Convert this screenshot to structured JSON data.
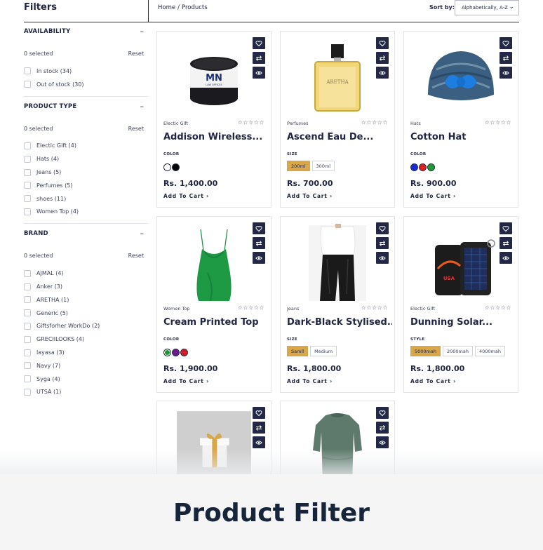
{
  "header": {
    "filters_title": "Filters",
    "breadcrumb": {
      "home": "Home",
      "separator": "/",
      "current": "Products"
    },
    "sort_label": "Sort by:",
    "sort_value": "Alphabetically, A-Z"
  },
  "sidebar": {
    "availability": {
      "title": "AVAILABILITY",
      "selected": "0 selected",
      "reset": "Reset",
      "options": [
        "In stock (34)",
        "Out of stock (30)"
      ]
    },
    "product_type": {
      "title": "PRODUCT TYPE",
      "selected": "0 selected",
      "reset": "Reset",
      "options": [
        "Electic Gift (4)",
        "Hats (4)",
        "Jeans (5)",
        "Perfumes (5)",
        "shoes (11)",
        "Women Top (4)"
      ]
    },
    "brand": {
      "title": "BRAND",
      "selected": "0 selected",
      "reset": "Reset",
      "options": [
        "AJMAL (4)",
        "Anker (3)",
        "ARETHA (1)",
        "Generic (5)",
        "Giftsforher WorkDo (2)",
        "GRECIILOOKS (4)",
        "layasa (3)",
        "Navy (7)",
        "Syga (4)",
        "UTSA (1)"
      ]
    }
  },
  "products": [
    {
      "category": "Electic Gift",
      "name": "Addison Wireless...",
      "option_label": "COLOR",
      "colors": [
        "#ffffff",
        "#000000"
      ],
      "price": "Rs. 1,400.00",
      "cart": "Add To Cart",
      "image": "speaker"
    },
    {
      "category": "Perfumes",
      "name": "Ascend Eau De...",
      "option_label": "SIZE",
      "chips": [
        "200ml",
        "300ml"
      ],
      "active_chip": 0,
      "price": "Rs. 700.00",
      "cart": "Add To Cart",
      "image": "perfume",
      "image_text": "ARETHA"
    },
    {
      "category": "Hats",
      "name": "Cotton Hat",
      "option_label": "COLOR",
      "colors": [
        "#1a2bd6",
        "#e02020",
        "#1e9a35"
      ],
      "price": "Rs. 900.00",
      "cart": "Add To Cart",
      "image": "hat"
    },
    {
      "category": "Women Top",
      "name": "Cream Printed Top",
      "option_label": "COLOR",
      "colors": [
        "#1e9a35",
        "#6a1a8c",
        "#d01c24"
      ],
      "price": "Rs. 1,900.00",
      "cart": "Add To Cart",
      "image": "top"
    },
    {
      "category": "Jeans",
      "name": "Dark-Black Stylised...",
      "option_label": "SIZE",
      "chips": [
        "Samll",
        "Medium"
      ],
      "active_chip": 0,
      "price": "Rs. 1,800.00",
      "cart": "Add To Cart",
      "image": "jeans"
    },
    {
      "category": "Electic Gift",
      "name": "Dunning Solar...",
      "option_label": "STYLE",
      "chips": [
        "5000mah",
        "2000mah",
        "4000mah"
      ],
      "active_chip": 0,
      "price": "Rs. 1,800.00",
      "cart": "Add To Cart",
      "image": "powerbank",
      "image_text": "USA"
    },
    {
      "category": "",
      "name": "",
      "image": "gift"
    },
    {
      "category": "",
      "name": "",
      "image": "dress"
    }
  ],
  "icons": {
    "wishlist": "heart-icon",
    "compare": "compare-arrows-icon",
    "quickview": "eye-icon",
    "cart_arrow": "chevron-right-icon",
    "sort_arrow": "chevron-down-icon",
    "collapse": "minus-icon"
  },
  "stars": "☆☆☆☆☆",
  "banner": {
    "title": "Product Filter"
  },
  "colors": {
    "navy": "#232846",
    "accent_gold": "#d9a648",
    "border": "#e2e4ea"
  }
}
